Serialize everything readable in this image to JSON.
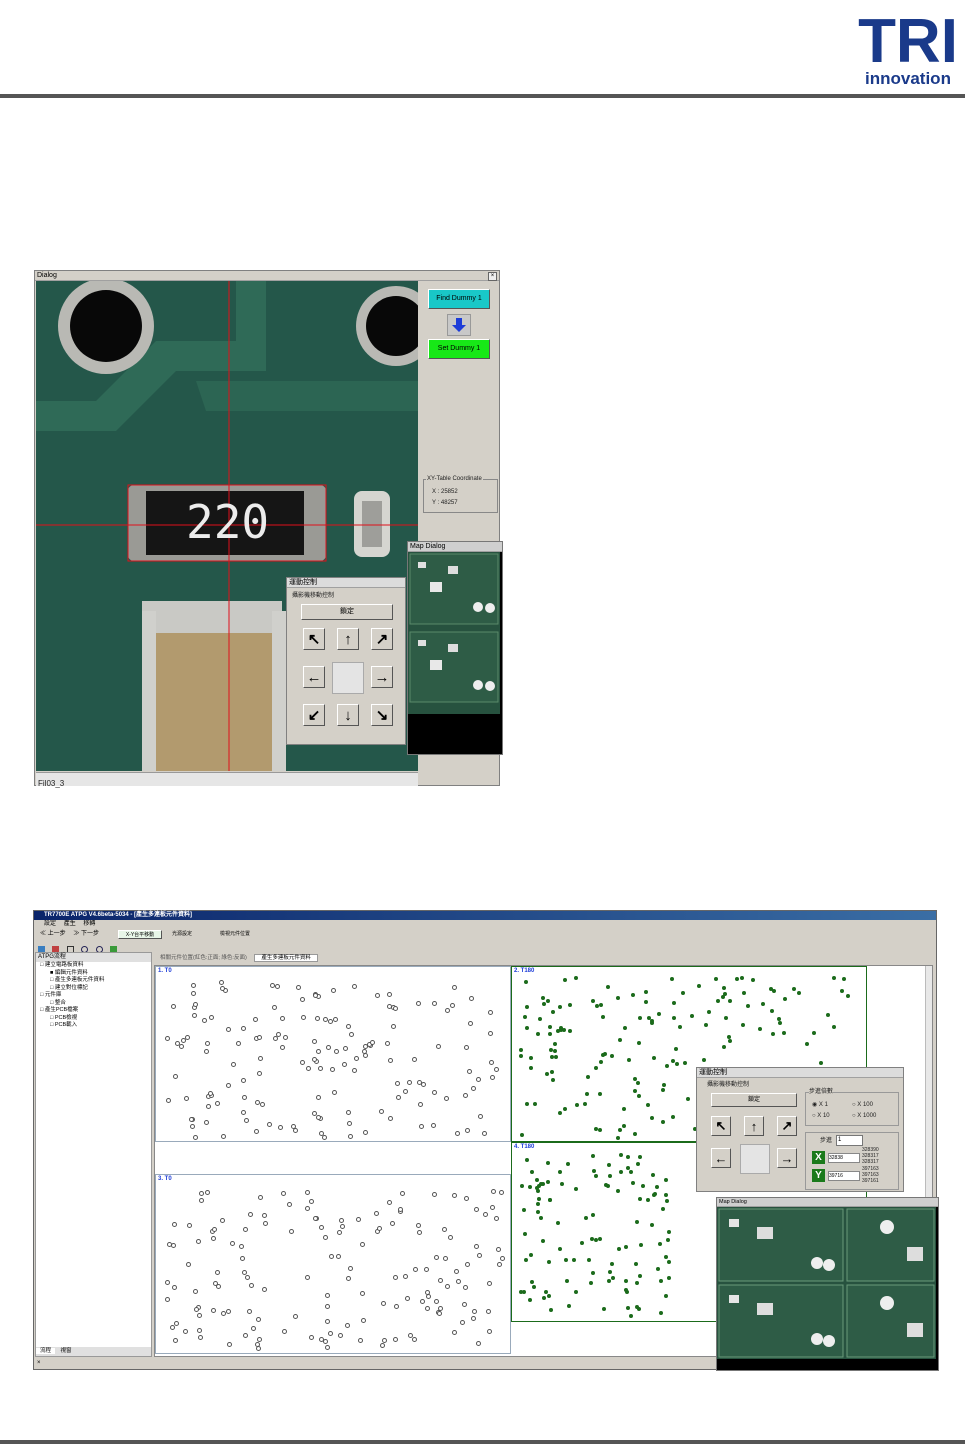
{
  "logo": {
    "top": "TRI",
    "bottom": "innovation",
    "color": "#1a3a8a"
  },
  "dialog1": {
    "title": "Dialog",
    "close": "×",
    "status": "Fil03_3",
    "find_button": "Find Dummy 1",
    "set_button": "Set Dummy 1",
    "coord_group": "XY-Table Coordinate",
    "coord_x": "X : 25852",
    "coord_y": "Y : 48257",
    "component_text": "220",
    "motion": {
      "title": "運動控制",
      "group": "攝影機移動控制",
      "center_button": "鎖定"
    },
    "map_title": "Map Dialog",
    "colors": {
      "find": "#19c8c8",
      "set": "#17e817",
      "arrow": "#1c3cd8",
      "crosshair": "#e0101a"
    }
  },
  "app": {
    "title": "TR7700E ATPG V4.6beta-5034 - [產生多連板元件資料]",
    "menu": [
      "設定",
      "產生",
      "移轉"
    ],
    "nav": [
      "≪ 上一步",
      "≫ 下一步"
    ],
    "tool_xy": "X-Y台平移動",
    "tool_light": "光源設定",
    "tool_pos": "檢視元件位置",
    "sidebar_title": "ATPG流程",
    "tree": [
      "建立電路板資料",
      "編輯元件資料",
      "產生多連板元件資料",
      "建立對位標記",
      "元件庫",
      "整合",
      "產生PCB檔案",
      "PCB檢視",
      "PCB載入"
    ],
    "sidebar_tabs": [
      "流程",
      "視窗"
    ],
    "tabs": [
      "相關元件位置(紅色:正面; 綠色:反面)",
      "產生多連板元件資料"
    ],
    "panels": [
      "1. T0",
      "2. T180",
      "3. T0",
      "4. T180"
    ],
    "motion": {
      "title": "運動控制",
      "group": "攝影機移動控制",
      "center_button": "鎖定",
      "step_group": "步進倍數",
      "radios": [
        "X 1",
        "X 100",
        "X 10",
        "X 1000"
      ],
      "step_label": "步進",
      "step_value": "1",
      "x_label": "X",
      "y_label": "Y",
      "x_value": "32838",
      "y_value": "39716",
      "x_list": [
        "328390",
        "328317",
        "328317"
      ],
      "y_list": [
        "397163",
        "397163",
        "397161"
      ]
    },
    "map_title": "Map Dialog",
    "statusbar": "×"
  }
}
